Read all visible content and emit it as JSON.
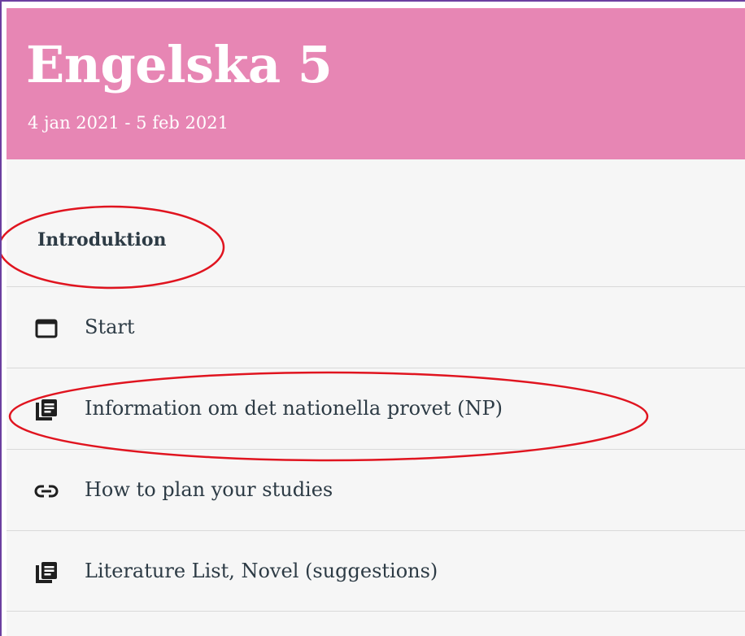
{
  "course": {
    "title": "Engelska 5",
    "dates": "4 jan 2021 - 5 feb 2021",
    "color": "#e786b4"
  },
  "module": {
    "heading": "Introduktion",
    "items": [
      {
        "label": "Start",
        "icon": "page-icon"
      },
      {
        "label": "Information om det nationella provet (NP)",
        "icon": "assignment-icon"
      },
      {
        "label": "How to plan your studies",
        "icon": "link-icon"
      },
      {
        "label": "Literature List, Novel (suggestions)",
        "icon": "assignment-icon"
      }
    ]
  },
  "annotation_color": "#e0141f"
}
